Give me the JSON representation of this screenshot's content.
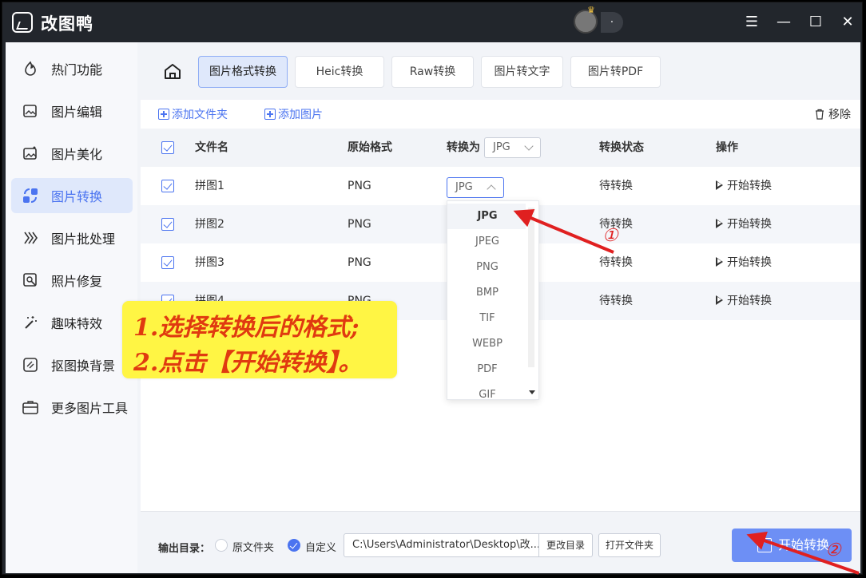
{
  "app": {
    "title": "改图鸭",
    "user_name": "."
  },
  "window_controls": {
    "menu": "☰",
    "minimize": "—",
    "maximize": "☐",
    "close": "✕"
  },
  "sidebar": {
    "items": [
      {
        "label": "热门功能",
        "icon": "flame-icon"
      },
      {
        "label": "图片编辑",
        "icon": "image-edit-icon"
      },
      {
        "label": "图片美化",
        "icon": "image-beautify-icon"
      },
      {
        "label": "图片转换",
        "icon": "image-convert-icon",
        "active": true
      },
      {
        "label": "图片批处理",
        "icon": "batch-icon"
      },
      {
        "label": "照片修复",
        "icon": "photo-repair-icon"
      },
      {
        "label": "趣味特效",
        "icon": "magic-wand-icon"
      },
      {
        "label": "抠图换背景",
        "icon": "cutout-icon"
      },
      {
        "label": "更多图片工具",
        "icon": "toolbox-icon"
      }
    ]
  },
  "tabs": [
    {
      "label": "图片格式转换",
      "active": true
    },
    {
      "label": "Heic转换"
    },
    {
      "label": "Raw转换"
    },
    {
      "label": "图片转文字"
    },
    {
      "label": "图片转PDF"
    }
  ],
  "toolbar": {
    "add_folder": "添加文件夹",
    "add_image": "添加图片",
    "remove": "移除"
  },
  "table": {
    "headers": {
      "name": "文件名",
      "orig": "原始格式",
      "convert_to": "转换为",
      "convert_to_value": "JPG",
      "status": "转换状态",
      "action": "操作"
    },
    "rows": [
      {
        "name": "拼图1",
        "orig": "PNG",
        "target": "JPG",
        "status": "待转换",
        "action": "开始转换"
      },
      {
        "name": "拼图2",
        "orig": "PNG",
        "status": "待转换",
        "action": "开始转换"
      },
      {
        "name": "拼图3",
        "orig": "PNG",
        "status": "待转换",
        "action": "开始转换"
      },
      {
        "name": "拼图4",
        "orig": "PNG",
        "status": "待转换",
        "action": "开始转换"
      }
    ]
  },
  "dropdown": {
    "options": [
      "JPG",
      "JPEG",
      "PNG",
      "BMP",
      "TIF",
      "WEBP",
      "PDF",
      "GIF"
    ],
    "selected": "JPG"
  },
  "callout": {
    "line1": "1.选择转换后的格式;",
    "line2": "2.点击【开始转换】。"
  },
  "annotations": {
    "marker1": "①",
    "marker2": "②",
    "arrow_color": "#e02020"
  },
  "footer": {
    "label": "输出目录：",
    "option_original": "原文件夹",
    "option_custom": "自定义",
    "path": "C:\\Users\\Administrator\\Desktop\\改...",
    "change_dir": "更改目录",
    "open_folder": "打开文件夹",
    "start": "开始转换"
  },
  "colors": {
    "accent": "#4b74f0",
    "titlebar": "#22262c",
    "callout_bg": "#fff544",
    "callout_text": "#e03a10"
  }
}
